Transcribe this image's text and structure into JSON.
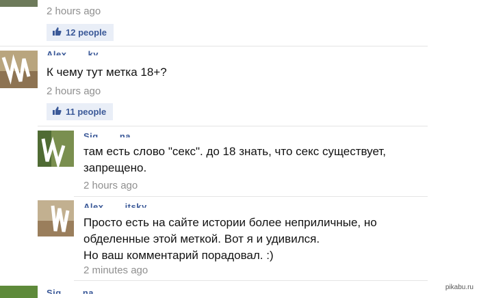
{
  "comments": [
    {
      "time": "2 hours ago",
      "likes": "12 people"
    },
    {
      "author": "Alex… …ky",
      "text": "К чему тут метка 18+?",
      "time": "2 hours ago",
      "likes": "11 people"
    }
  ],
  "replies": [
    {
      "author": "Sig… …na",
      "text_lines": [
        "там есть слово \"секс\". до 18 знать, что секс существует,",
        "запрещено."
      ],
      "time": "2 hours ago"
    },
    {
      "author": "Alex… …itsky",
      "text_lines": [
        "Просто есть на сайте истории более неприличные, но",
        "обделенные этой меткой. Вот я и удивился.",
        "Но ваш комментарий порадовал. :)"
      ],
      "time": "2 minutes ago"
    },
    {
      "author": "Sig… …na"
    }
  ],
  "watermark": "pikabu.ru",
  "icons": {
    "like": "thumbs-up-icon"
  },
  "colors": {
    "link": "#3b5998",
    "like_bg": "#e9eef7",
    "timestamp": "#8f8f8f",
    "divider": "#e4e4e4"
  }
}
